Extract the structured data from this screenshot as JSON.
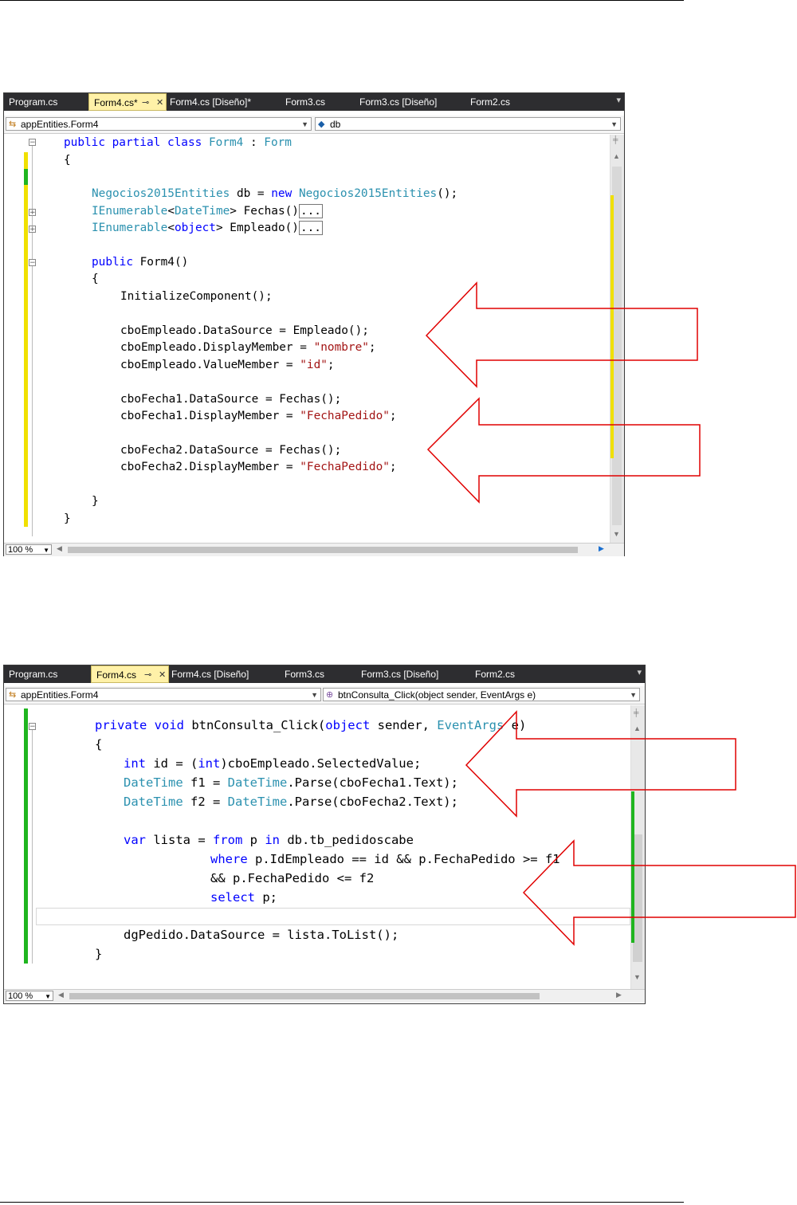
{
  "screens": [
    {
      "tabs": [
        {
          "label": "Program.cs"
        },
        {
          "label": "Form4.cs*",
          "active": true
        },
        {
          "label": "Form4.cs [Diseño]*"
        },
        {
          "label": "Form3.cs"
        },
        {
          "label": "Form3.cs [Diseño]"
        },
        {
          "label": "Form2.cs"
        }
      ],
      "nav_left": "appEntities.Form4",
      "nav_right": "db",
      "zoom": "100 %",
      "code": [
        "public partial class Form4 : Form",
        "{",
        "Negocios2015Entities db = new Negocios2015Entities();",
        "IEnumerable<DateTime> Fechas()...",
        "IEnumerable<object> Empleado()...",
        "public Form4()",
        "{",
        "InitializeComponent();",
        "cboEmpleado.DataSource = Empleado();",
        "cboEmpleado.DisplayMember = \"nombre\";",
        "cboEmpleado.ValueMember = \"id\";",
        "cboFecha1.DataSource = Fechas();",
        "cboFecha1.DisplayMember = \"FechaPedido\";",
        "cboFecha2.DataSource = Fechas();",
        "cboFecha2.DisplayMember = \"FechaPedido\";",
        "}",
        "}"
      ]
    },
    {
      "tabs": [
        {
          "label": "Program.cs"
        },
        {
          "label": "Form4.cs",
          "active": true
        },
        {
          "label": "Form4.cs [Diseño]"
        },
        {
          "label": "Form3.cs"
        },
        {
          "label": "Form3.cs [Diseño]"
        },
        {
          "label": "Form2.cs"
        }
      ],
      "nav_left": "appEntities.Form4",
      "nav_right": "btnConsulta_Click(object sender, EventArgs e)",
      "zoom": "100 %",
      "code": [
        "private void btnConsulta_Click(object sender, EventArgs e)",
        "{",
        "int id = (int)cboEmpleado.SelectedValue;",
        "DateTime f1 = DateTime.Parse(cboFecha1.Text);",
        "DateTime f2 = DateTime.Parse(cboFecha2.Text);",
        "var lista = from p in db.tb_pedidoscabe",
        "where p.IdEmpleado == id && p.FechaPedido >= f1",
        "&& p.FechaPedido <= f2",
        "select p;",
        "dgPedido.DataSource = lista.ToList();",
        "}"
      ]
    }
  ],
  "colors": {
    "keyword": "#0000ff",
    "type": "#2b91af",
    "string": "#a31515",
    "arrow": "#e00000",
    "change_saved": "#1fb51f",
    "change_unsaved": "#f0e000"
  },
  "icons": [
    "pin-icon",
    "close-icon",
    "class-icon",
    "field-icon",
    "method-icon",
    "collapse-icon",
    "expand-icon",
    "dropdown-icon"
  ]
}
